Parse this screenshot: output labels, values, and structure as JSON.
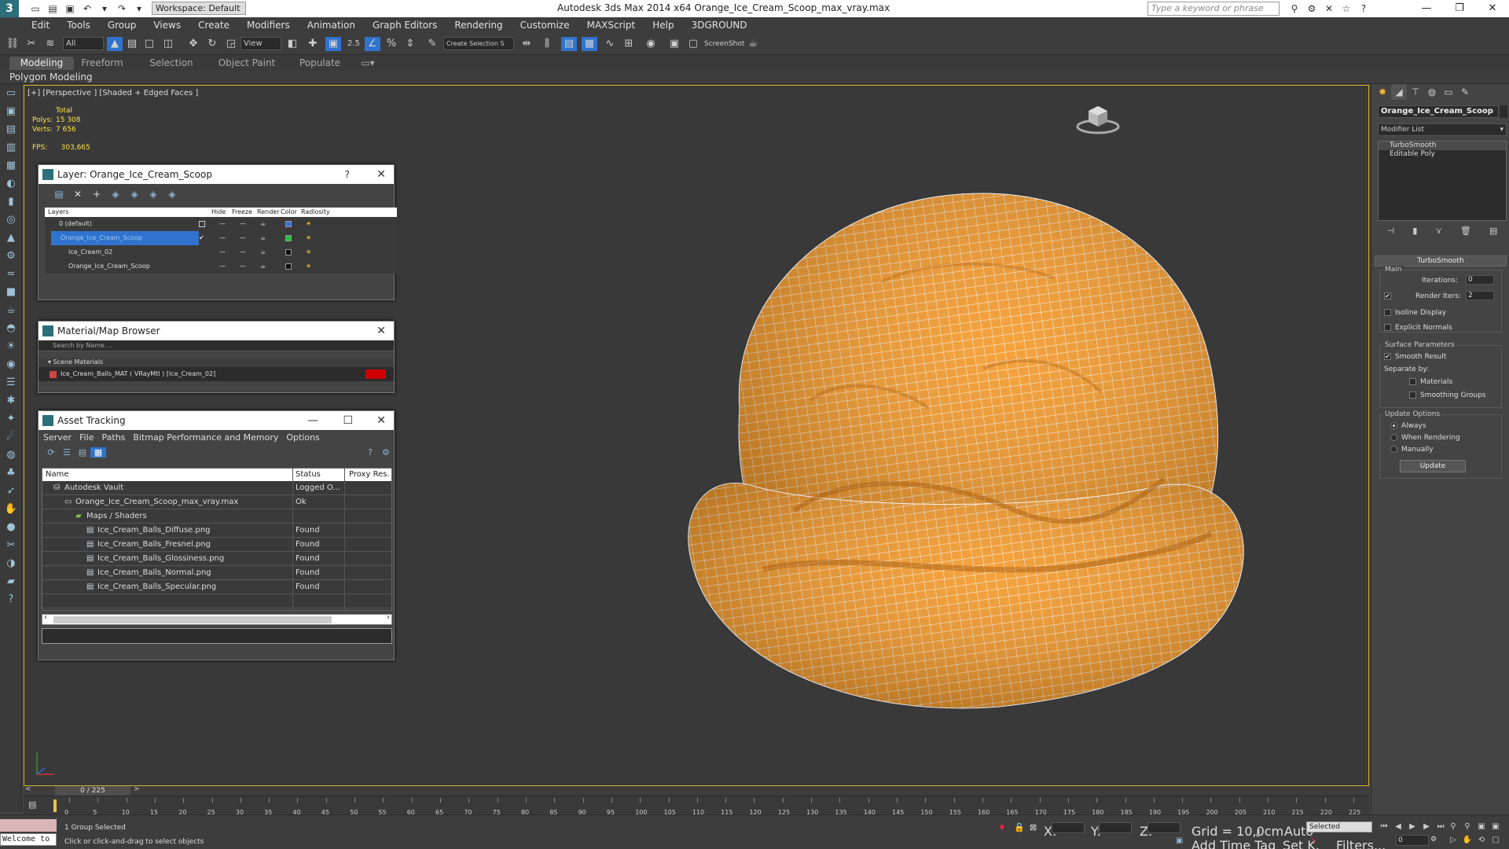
{
  "titlebar": {
    "logo_glyph": "3",
    "workspace": "Workspace: Default",
    "app_title": "Autodesk 3ds Max  2014 x64      Orange_Ice_Cream_Scoop_max_vray.max",
    "search_placeholder": "Type a keyword or phrase"
  },
  "menu": [
    "Edit",
    "Tools",
    "Group",
    "Views",
    "Create",
    "Modifiers",
    "Animation",
    "Graph Editors",
    "Rendering",
    "Customize",
    "MAXScript",
    "Help",
    "3DGROUND"
  ],
  "toolbar": {
    "filter_dropdown": "All",
    "refcoord_dropdown": "View",
    "selection_set": "Create Selection S",
    "angle_snap_label": "2.5",
    "screenshot_label": "ScreenShot"
  },
  "ribbon_tabs": [
    "Modeling",
    "Freeform",
    "Selection",
    "Object Paint",
    "Populate"
  ],
  "polygon_modeling": "Polygon Modeling",
  "viewport": {
    "label": "[+] [Perspective ] [Shaded + Edged Faces ]",
    "stats_total": "Total",
    "polys_label": "Polys:",
    "polys_value": "15 308",
    "verts_label": "Verts:",
    "verts_value": "7 656",
    "fps_label": "FPS:",
    "fps_value": "303,665",
    "mesh_color": "#f39a2c",
    "wire_color": "#ffffff"
  },
  "layer_panel": {
    "title": "Layer: Orange_Ice_Cream_Scoop",
    "help": "?",
    "columns": [
      "Layers",
      "Hide",
      "Freeze",
      "Render",
      "Color",
      "Radiosity"
    ],
    "rows": [
      {
        "name": "0 (default)",
        "color": "#3b6fd8"
      },
      {
        "name": "Orange_Ice_Cream_Scoop",
        "color": "#22c23a"
      },
      {
        "name": "Ice_Cream_02",
        "color": "#111111"
      },
      {
        "name": "Orange_Ice_Cream_Scoop",
        "color": "#111111"
      }
    ]
  },
  "material_browser": {
    "title": "Material/Map Browser",
    "search_placeholder": "Search by Name ...",
    "section": "Scene Materials",
    "item": "Ice_Cream_Balls_MAT  ( VRayMtl )  [Ice_Cream_02]"
  },
  "asset_tracking": {
    "title": "Asset Tracking",
    "menu": [
      "Server",
      "File",
      "Paths",
      "Bitmap Performance and Memory",
      "Options"
    ],
    "columns": [
      "Name",
      "Status",
      "Proxy Res."
    ],
    "rows": [
      {
        "name": "Autodesk Vault",
        "status": "Logged O...",
        "indent": 0
      },
      {
        "name": "Orange_Ice_Cream_Scoop_max_vray.max",
        "status": "Ok",
        "indent": 1
      },
      {
        "name": "Maps / Shaders",
        "status": "",
        "indent": 2
      },
      {
        "name": "Ice_Cream_Balls_Diffuse.png",
        "status": "Found",
        "indent": 3
      },
      {
        "name": "Ice_Cream_Balls_Fresnel.png",
        "status": "Found",
        "indent": 3
      },
      {
        "name": "Ice_Cream_Balls_Glossiness.png",
        "status": "Found",
        "indent": 3
      },
      {
        "name": "Ice_Cream_Balls_Normal.png",
        "status": "Found",
        "indent": 3
      },
      {
        "name": "Ice_Cream_Balls_Specular.png",
        "status": "Found",
        "indent": 3
      }
    ]
  },
  "command_panel": {
    "object_name": "Orange_Ice_Cream_Scoop",
    "modifier_list": "Modifier List",
    "stack": [
      "TurboSmooth",
      "Editable Poly"
    ],
    "rollout": "TurboSmooth",
    "main_group": "Main",
    "iterations_label": "Iterations:",
    "iterations_value": "0",
    "render_iters_label": "Render Iters:",
    "render_iters_value": "2",
    "isoline": "Isoline Display",
    "explicit_normals": "Explicit Normals",
    "surface_group": "Surface Parameters",
    "smooth_result": "Smooth Result",
    "separate_by": "Separate by:",
    "materials": "Materials",
    "smoothing_groups": "Smoothing Groups",
    "update_group": "Update Options",
    "always": "Always",
    "when_rendering": "When Rendering",
    "manually": "Manually",
    "update_button": "Update"
  },
  "timeline": {
    "slider": "0 / 225",
    "ticks": [
      "0",
      "5",
      "10",
      "15",
      "20",
      "25",
      "30",
      "35",
      "40",
      "45",
      "50",
      "55",
      "60",
      "65",
      "70",
      "75",
      "80",
      "85",
      "90",
      "95",
      "100",
      "105",
      "110",
      "115",
      "120",
      "125",
      "130",
      "135",
      "140",
      "145",
      "150",
      "155",
      "160",
      "165",
      "170",
      "175",
      "180",
      "185",
      "190",
      "195",
      "200",
      "205",
      "210",
      "215",
      "220",
      "225"
    ]
  },
  "status": {
    "welcome": "Welcome to",
    "selection_info": "1 Group Selected",
    "prompt": "Click or click-and-drag to select objects",
    "x_label": "X:",
    "y_label": "Y:",
    "z_label": "Z:",
    "grid": "Grid = 10,0cm",
    "add_time_tag": "Add Time Tag",
    "auto": "Auto",
    "set_key": "Set K.",
    "selected_dropdown": "Selected",
    "filters": "Filters...",
    "frame_value": "0"
  }
}
